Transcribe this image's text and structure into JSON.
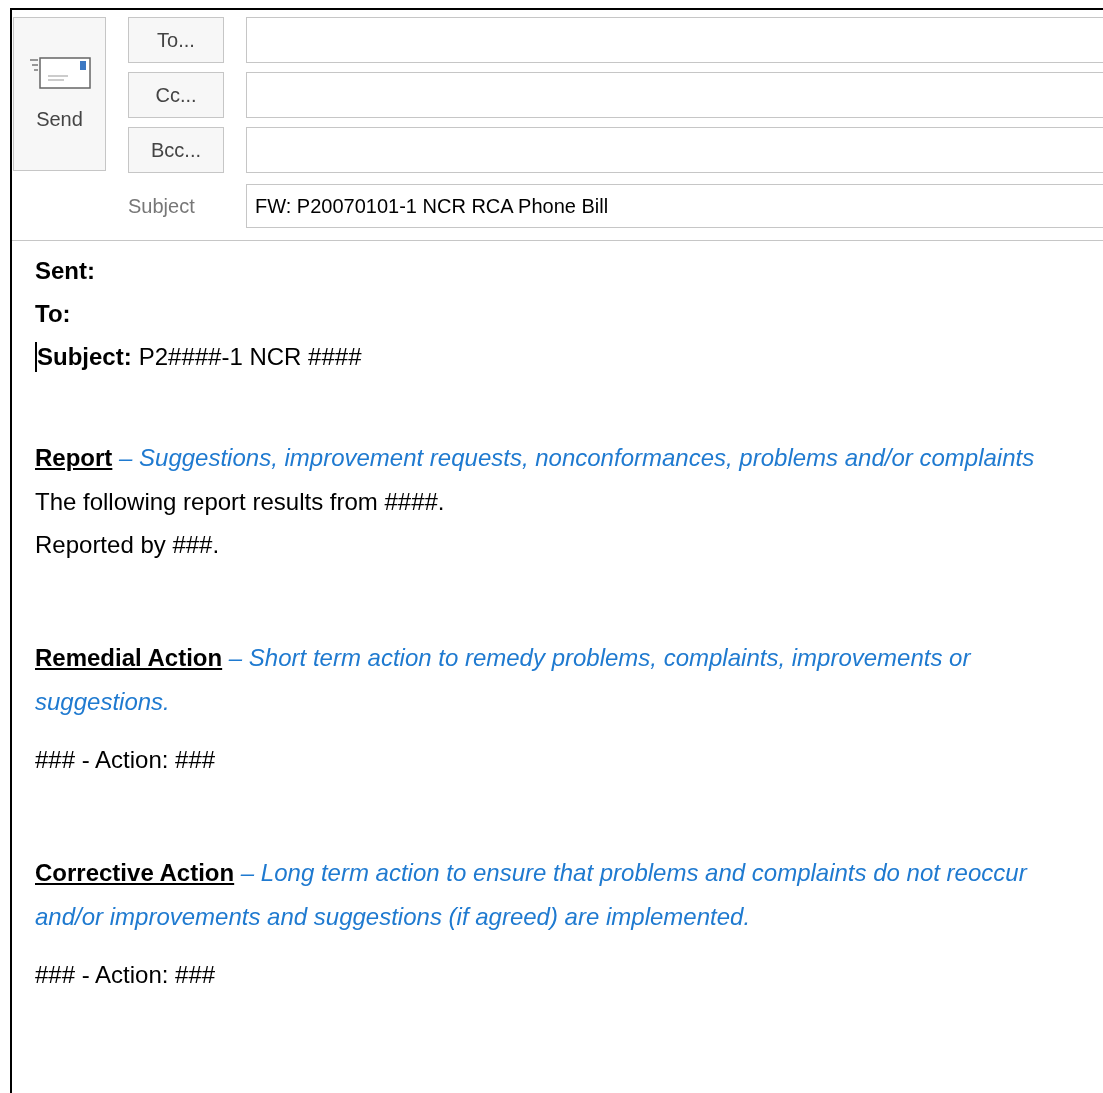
{
  "send_button": {
    "label": "Send"
  },
  "recipients": [
    {
      "button": "To..."
    },
    {
      "button": "Cc..."
    },
    {
      "button": "Bcc..."
    }
  ],
  "subject": {
    "label": "Subject",
    "value": "FW: P20070101-1 NCR RCA Phone Bill"
  },
  "body": {
    "header_lines": [
      {
        "label": "Sent:",
        "cursor": false
      },
      {
        "label": "To:",
        "cursor": false
      },
      {
        "label": "Subject:",
        "value": "P2####-1 NCR ####",
        "cursor": true
      }
    ],
    "sections": [
      {
        "heading": "Report",
        "description": "– Suggestions, improvement requests, nonconformances, problems and/or complaints",
        "lines": [
          "The following report results from ####.",
          "Reported by ###."
        ]
      },
      {
        "heading": "Remedial Action",
        "description": "– Short term action to remedy problems, complaints, improvements or suggestions.",
        "lines": [
          "### -  Action: ###"
        ]
      },
      {
        "heading": "Corrective Action",
        "description": "– Long term action to ensure that problems and complaints do not reoccur and/or improvements and suggestions (if agreed) are implemented.",
        "lines": [
          "### -  Action: ###"
        ]
      }
    ]
  }
}
